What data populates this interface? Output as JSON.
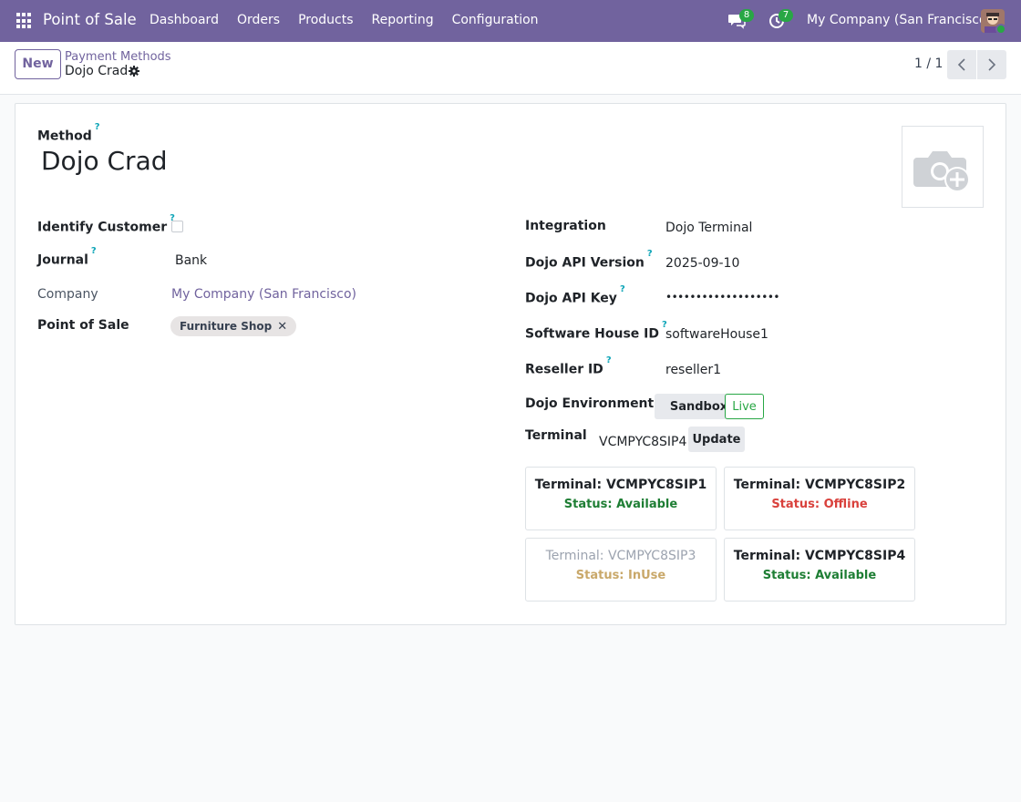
{
  "navbar": {
    "app_name": "Point of Sale",
    "menu": [
      "Dashboard",
      "Orders",
      "Products",
      "Reporting",
      "Configuration"
    ],
    "messages_count": "8",
    "activities_count": "7",
    "company": "My Company (San Francisco)"
  },
  "control": {
    "new_label": "New",
    "breadcrumb": "Payment Methods",
    "record_name": "Dojo Crad",
    "pager": "1 / 1"
  },
  "form": {
    "method_label": "Method",
    "method_name": "Dojo Crad",
    "identify_customer_label": "Identify Customer",
    "journal_label": "Journal",
    "journal_value": "Bank",
    "company_label": "Company",
    "company_value": "My Company (San Francisco)",
    "pos_label": "Point of Sale",
    "pos_tag": "Furniture Shop",
    "integration_label": "Integration",
    "integration_value": "Dojo Terminal",
    "api_version_label": "Dojo API Version",
    "api_version_value": "2025-09-10",
    "api_key_label": "Dojo API Key",
    "api_key_value": "•••••••••••••••••••",
    "software_house_label": "Software House ID",
    "software_house_value": "softwareHouse1",
    "reseller_label": "Reseller ID",
    "reseller_value": "reseller1",
    "environment_label": "Dojo Environment",
    "env_sandbox": "Sandbox",
    "env_live": "Live",
    "terminal_label": "Terminal",
    "terminal_value": "VCMPYC8SIP4",
    "update_label": "Update",
    "help_mark": "?"
  },
  "terminals": [
    {
      "name": "Terminal: VCMPYC8SIP1",
      "status": "Status: Available",
      "color": "#1e7e34"
    },
    {
      "name": "Terminal: VCMPYC8SIP2",
      "status": "Status: Offline",
      "color": "#d9413c"
    },
    {
      "name": "Terminal: VCMPYC8SIP3",
      "status": "Status: InUse",
      "color": "#c9a86a"
    },
    {
      "name": "Terminal: VCMPYC8SIP4",
      "status": "Status: Available",
      "color": "#1e7e34"
    }
  ]
}
